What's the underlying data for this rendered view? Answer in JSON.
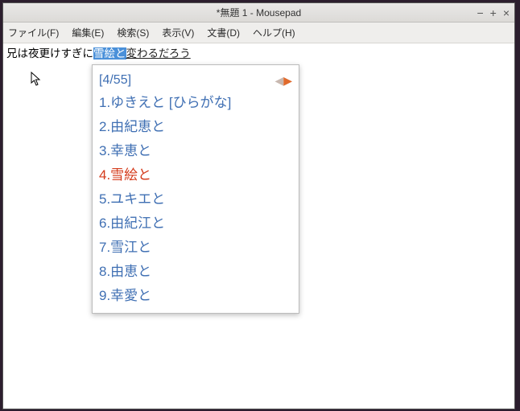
{
  "window": {
    "title": "*無題 1 - Mousepad"
  },
  "menu": {
    "file": "ファイル(F)",
    "edit": "編集(E)",
    "search": "検索(S)",
    "view": "表示(V)",
    "document": "文書(D)",
    "help": "ヘルプ(H)"
  },
  "text": {
    "before": "兄は夜更けすぎに",
    "selected": "雪絵と",
    "composing": "変わるだろう"
  },
  "ime": {
    "page": "[4/55]",
    "candidates": [
      {
        "n": "1.",
        "t": "ゆきえと [ひらがな]"
      },
      {
        "n": "2.",
        "t": "由紀恵と"
      },
      {
        "n": "3.",
        "t": "幸恵と"
      },
      {
        "n": "4.",
        "t": "雪絵と"
      },
      {
        "n": "5.",
        "t": "ユキエと"
      },
      {
        "n": "6.",
        "t": "由紀江と"
      },
      {
        "n": "7.",
        "t": "雪江と"
      },
      {
        "n": "8.",
        "t": "由恵と"
      },
      {
        "n": "9.",
        "t": "幸愛と"
      }
    ],
    "highlight_index": 3
  }
}
